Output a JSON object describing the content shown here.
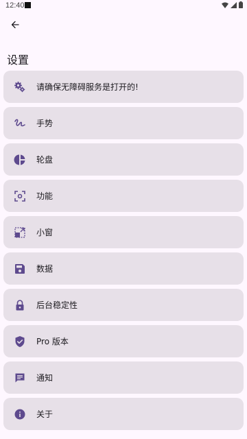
{
  "status_bar": {
    "time": "12:40",
    "icons": [
      "wifi-icon",
      "signal-icon",
      "battery-icon"
    ]
  },
  "header": {
    "back_icon": "arrow-back-icon",
    "title": "设置"
  },
  "menu": {
    "items": [
      {
        "label": "请确保无障碍服务是打开的!",
        "icon": "gears-icon"
      },
      {
        "label": "手势",
        "icon": "gesture-icon"
      },
      {
        "label": "轮盘",
        "icon": "pie-chart-icon"
      },
      {
        "label": "功能",
        "icon": "screenshot-frame-icon"
      },
      {
        "label": "小窗",
        "icon": "small-window-icon"
      },
      {
        "label": "数据",
        "icon": "save-icon"
      },
      {
        "label": "后台稳定性",
        "icon": "lock-icon"
      },
      {
        "label": "Pro 版本",
        "icon": "verified-shield-icon"
      },
      {
        "label": "通知",
        "icon": "message-icon"
      },
      {
        "label": "关于",
        "icon": "info-icon"
      }
    ]
  },
  "colors": {
    "background": "#fef7ff",
    "card": "#e7e0e8",
    "accent": "#5e4a8e"
  }
}
